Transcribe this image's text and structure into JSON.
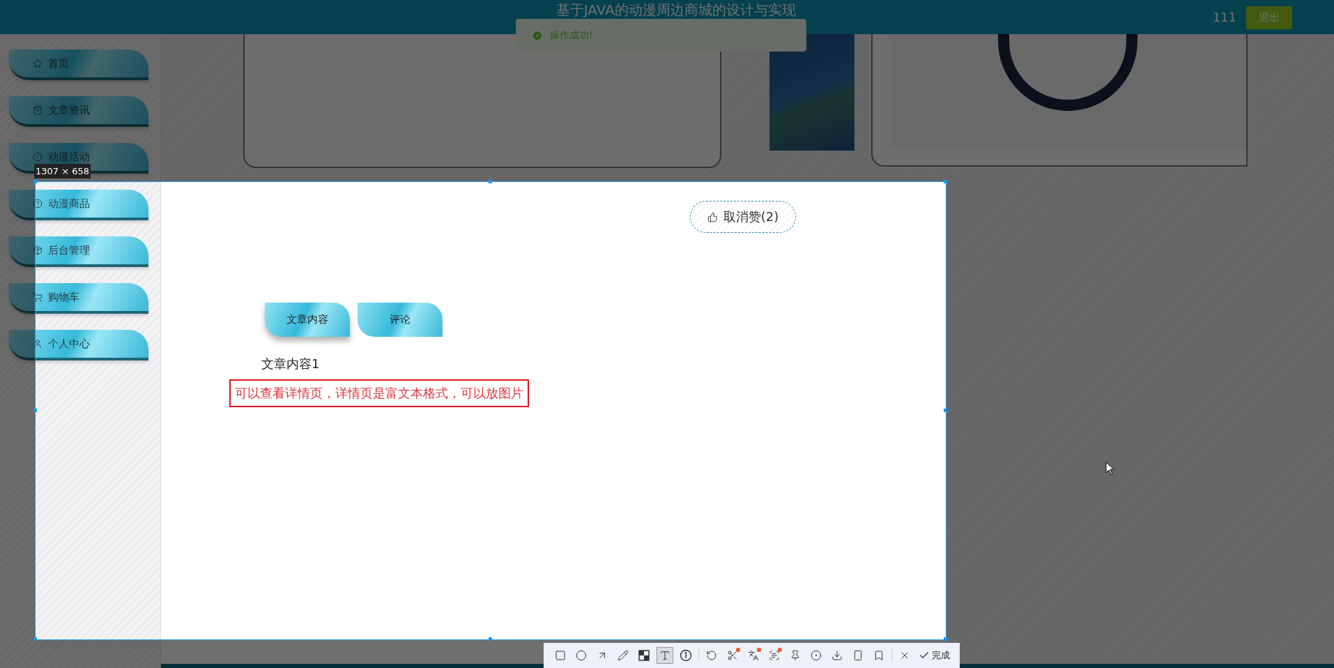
{
  "header": {
    "title": "基于JAVA的动漫周边商城的设计与实现",
    "user": "111",
    "logout": "退出"
  },
  "toast": {
    "text": "操作成功!"
  },
  "sidebar": {
    "items": [
      {
        "label": "首页",
        "kind": "star"
      },
      {
        "label": "文章资讯",
        "kind": "bag"
      },
      {
        "label": "动漫活动",
        "kind": "alert"
      },
      {
        "label": "动漫商品",
        "kind": "help"
      },
      {
        "label": "后台管理",
        "kind": "box"
      },
      {
        "label": "购物车",
        "kind": "cart"
      },
      {
        "label": "个人中心",
        "kind": "user"
      }
    ]
  },
  "detail": {
    "like_button": "取消赞(2)",
    "tabs": [
      {
        "label": "文章内容",
        "selected": true
      },
      {
        "label": "评论",
        "selected": false
      }
    ],
    "content": "文章内容1",
    "note": "可以查看详情页，详情页是富文本格式，可以放图片"
  },
  "capture": {
    "size_label": "1307 × 658",
    "tools": [
      {
        "kind": "rectangle",
        "selected": false,
        "dot": false
      },
      {
        "kind": "ellipse",
        "selected": false,
        "dot": false
      },
      {
        "kind": "arrow",
        "selected": false,
        "dot": false
      },
      {
        "kind": "pen",
        "selected": false,
        "dot": false
      },
      {
        "kind": "mosaic",
        "selected": false,
        "dot": false
      },
      {
        "kind": "text",
        "selected": true,
        "dot": false
      },
      {
        "kind": "number",
        "selected": false,
        "dot": false
      },
      {
        "kind": "divider"
      },
      {
        "kind": "undo",
        "selected": false,
        "dot": false
      },
      {
        "kind": "scissors",
        "selected": false,
        "dot": true
      },
      {
        "kind": "translate",
        "selected": false,
        "dot": true
      },
      {
        "kind": "ocr",
        "selected": false,
        "dot": true
      },
      {
        "kind": "pin",
        "selected": false,
        "dot": false
      },
      {
        "kind": "record",
        "selected": false,
        "dot": false
      },
      {
        "kind": "download",
        "selected": false,
        "dot": false
      },
      {
        "kind": "phone",
        "selected": false,
        "dot": false
      },
      {
        "kind": "bookmark",
        "selected": false,
        "dot": false
      },
      {
        "kind": "divider"
      },
      {
        "kind": "close",
        "selected": false,
        "dot": false
      }
    ],
    "done": "完成"
  }
}
